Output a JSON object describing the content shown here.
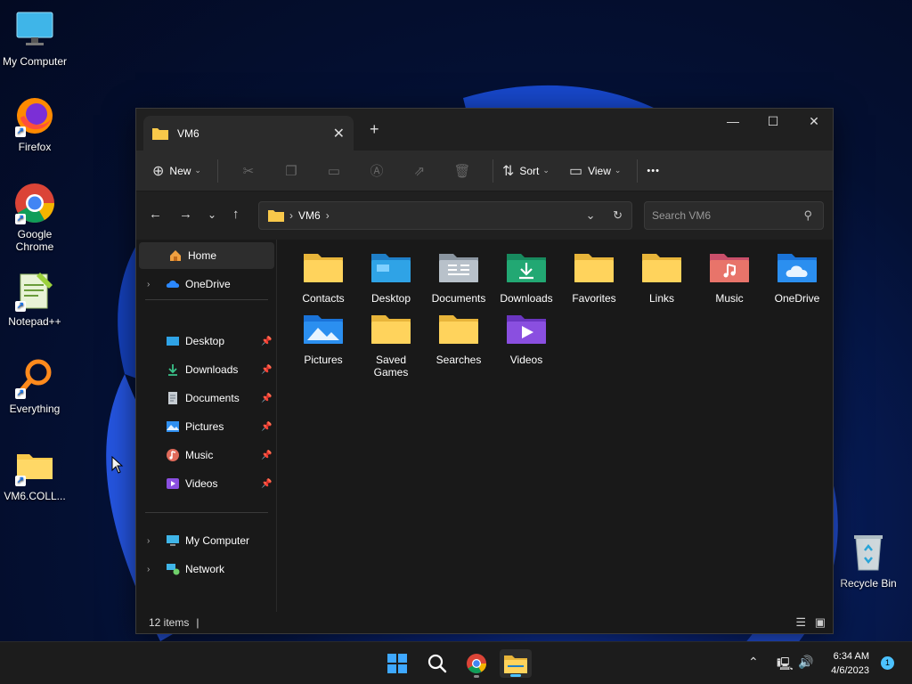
{
  "desktop": {
    "icons": [
      {
        "label": "My Computer"
      },
      {
        "label": "Firefox"
      },
      {
        "label": "Google Chrome"
      },
      {
        "label": "Notepad++"
      },
      {
        "label": "Everything"
      },
      {
        "label": "VM6.COLL..."
      },
      {
        "label": "Recycle Bin"
      }
    ]
  },
  "window": {
    "tab_title": "VM6",
    "close_glyph": "✕",
    "new_tab_glyph": "+",
    "controls": {
      "minimize": "—",
      "maximize": "☐",
      "close": "✕"
    },
    "toolbar": {
      "new_label": "New",
      "sort_label": "Sort",
      "view_label": "View",
      "more_glyph": "•••"
    },
    "address": {
      "crumbs": [
        "VM6"
      ]
    },
    "search": {
      "placeholder": "Search VM6"
    },
    "sidebar": {
      "home": "Home",
      "onedrive": "OneDrive",
      "quick": [
        {
          "label": "Desktop"
        },
        {
          "label": "Downloads"
        },
        {
          "label": "Documents"
        },
        {
          "label": "Pictures"
        },
        {
          "label": "Music"
        },
        {
          "label": "Videos"
        }
      ],
      "my_computer": "My Computer",
      "network": "Network"
    },
    "items": [
      {
        "label": "Contacts"
      },
      {
        "label": "Desktop"
      },
      {
        "label": "Documents"
      },
      {
        "label": "Downloads"
      },
      {
        "label": "Favorites"
      },
      {
        "label": "Links"
      },
      {
        "label": "Music"
      },
      {
        "label": "OneDrive"
      },
      {
        "label": "Pictures"
      },
      {
        "label": "Saved Games"
      },
      {
        "label": "Searches"
      },
      {
        "label": "Videos"
      }
    ],
    "status": {
      "count": "12 items",
      "separator": "|"
    }
  },
  "taskbar": {
    "time": "6:34 AM",
    "date": "4/6/2023",
    "notifications": "1"
  },
  "colors": {
    "accent": "#4cc2ff",
    "folder": "#f8c84a",
    "window_bg": "#191919"
  }
}
